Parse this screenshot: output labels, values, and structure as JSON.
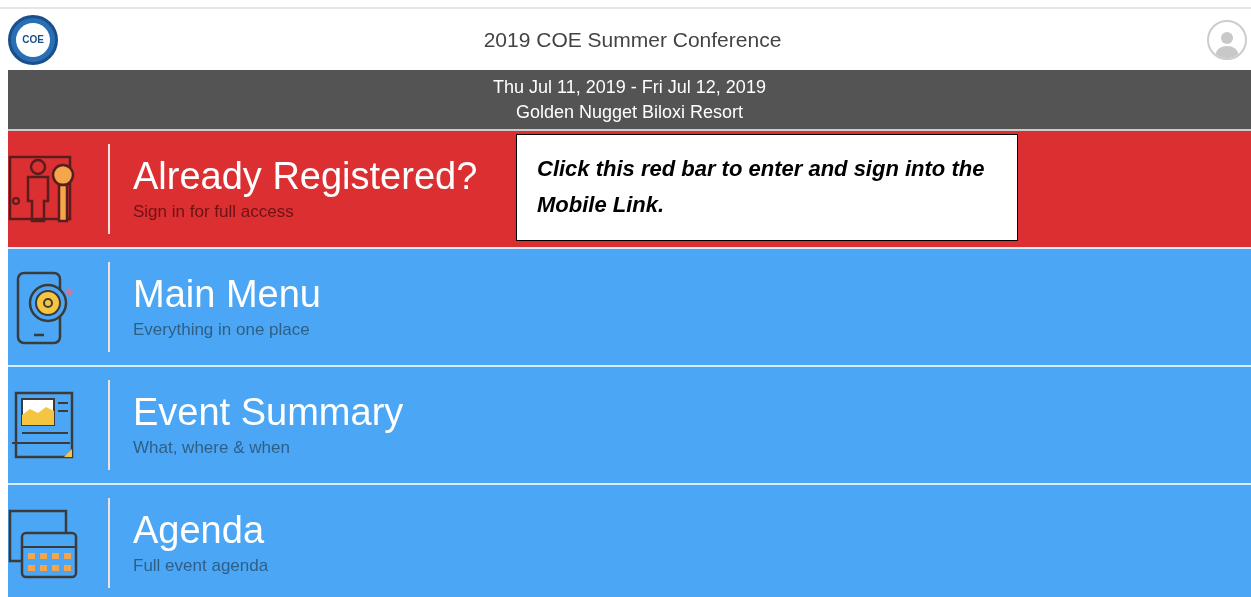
{
  "header": {
    "title": "2019 COE Summer Conference",
    "logo_text": "COE"
  },
  "event_bar": {
    "dates": "Thu Jul 11, 2019 - Fri Jul 12, 2019",
    "venue": "Golden Nugget Biloxi Resort"
  },
  "rows": [
    {
      "title": "Already Registered?",
      "subtitle": "Sign in for full access",
      "color": "#dc2f32"
    },
    {
      "title": "Main Menu",
      "subtitle": "Everything in one place",
      "color": "#4ba7f5"
    },
    {
      "title": "Event Summary",
      "subtitle": "What, where & when",
      "color": "#4ba7f5"
    },
    {
      "title": "Agenda",
      "subtitle": "Full event agenda",
      "color": "#4ba7f5"
    }
  ],
  "callout": {
    "text": "Click this red bar to enter and sign into the Mobile Link."
  }
}
